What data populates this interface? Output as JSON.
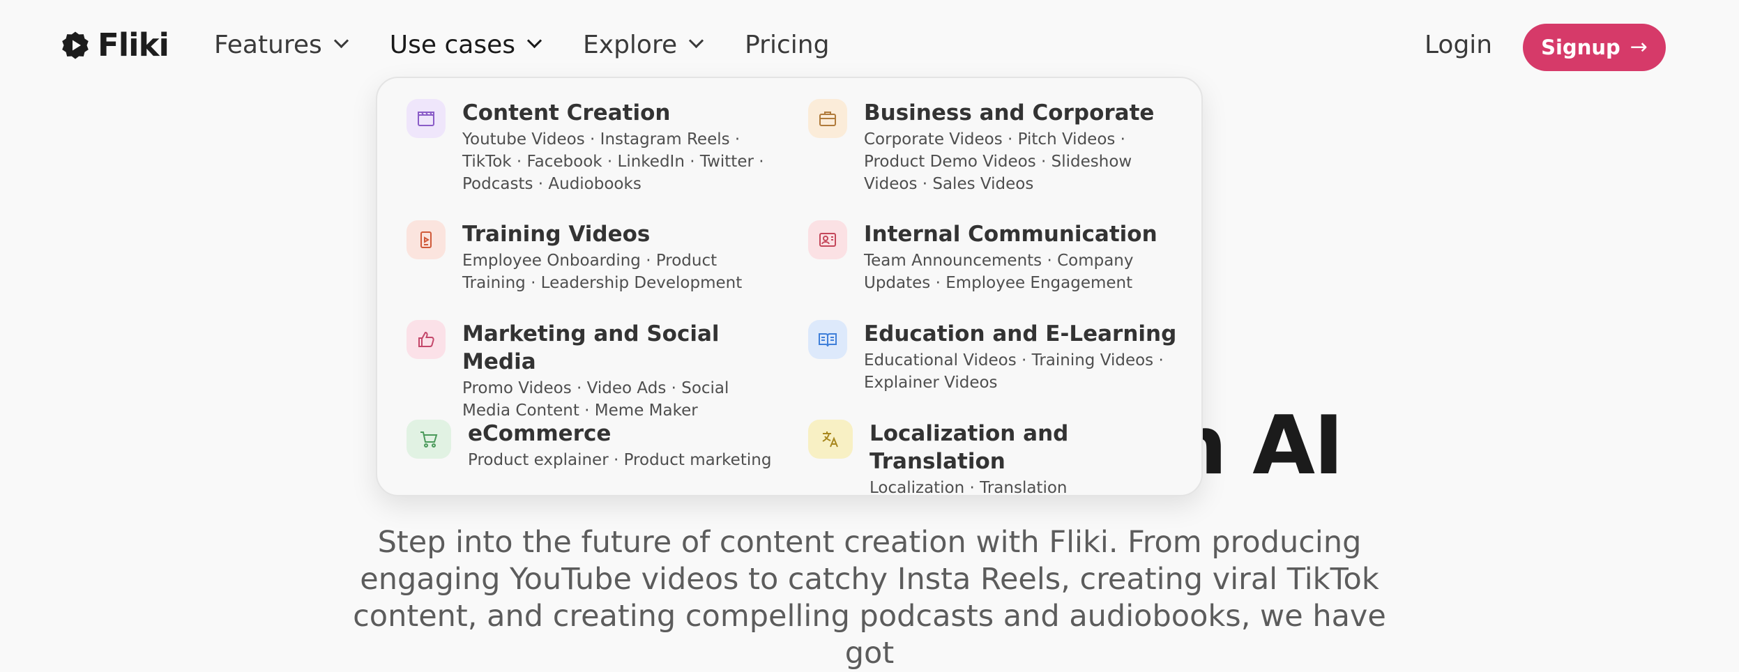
{
  "brand": {
    "name": "Fliki"
  },
  "nav": {
    "items": [
      {
        "label": "Features",
        "has_dropdown": true,
        "active": false
      },
      {
        "label": "Use cases",
        "has_dropdown": true,
        "active": true
      },
      {
        "label": "Explore",
        "has_dropdown": true,
        "active": false
      },
      {
        "label": "Pricing",
        "has_dropdown": false,
        "active": false
      }
    ],
    "login_label": "Login",
    "signup_label": "Signup"
  },
  "dropdown": {
    "items": [
      {
        "title": "Content Creation",
        "desc": "Youtube Videos · Instagram Reels · TikTok · Facebook · LinkedIn · Twitter · Podcasts · Audiobooks",
        "icon": "clapperboard-icon",
        "color": "#8a5cc7",
        "bg": "#efe6fb"
      },
      {
        "title": "Business and Corporate",
        "desc": "Corporate Videos · Pitch Videos · Product Demo Videos · Slideshow Videos · Sales Videos",
        "icon": "briefcase-icon",
        "color": "#b07a3a",
        "bg": "#fbecd9"
      },
      {
        "title": "Training Videos",
        "desc": "Employee Onboarding · Product Training · Leadership Development",
        "icon": "tablet-video-icon",
        "color": "#d05a3a",
        "bg": "#fbe4de"
      },
      {
        "title": "Internal Communication",
        "desc": "Team Announcements · Company Updates · Employee Engagement",
        "icon": "contact-card-icon",
        "color": "#c4475a",
        "bg": "#fbe1e4"
      },
      {
        "title": "Marketing and Social Media",
        "desc": "Promo Videos · Video Ads · Social Media Content · Meme Maker",
        "icon": "thumbs-up-icon",
        "color": "#c4476a",
        "bg": "#fbe1e8"
      },
      {
        "title": "Education and E-Learning",
        "desc": "Educational Videos · Training Videos · Explainer Videos",
        "icon": "open-book-icon",
        "color": "#3f7fd9",
        "bg": "#dde9fb"
      },
      {
        "title": "eCommerce",
        "desc": "Product explainer · Product marketing",
        "icon": "shopping-cart-icon",
        "color": "#4a9a5a",
        "bg": "#e1f2e3"
      },
      {
        "title": "Localization and Translation",
        "desc": "Localization · Translation",
        "icon": "translate-icon",
        "color": "#a8871e",
        "bg": "#f8f0c4"
      }
    ]
  },
  "hero": {
    "title": "Create videos with AI",
    "subtitle": "Step into the future of content creation with Fliki. From producing engaging YouTube videos to catchy Insta Reels, creating viral TikTok content, and creating compelling podcasts and audiobooks, we have got"
  },
  "colors": {
    "accent": "#d63a69",
    "background": "#f9f9f9"
  }
}
